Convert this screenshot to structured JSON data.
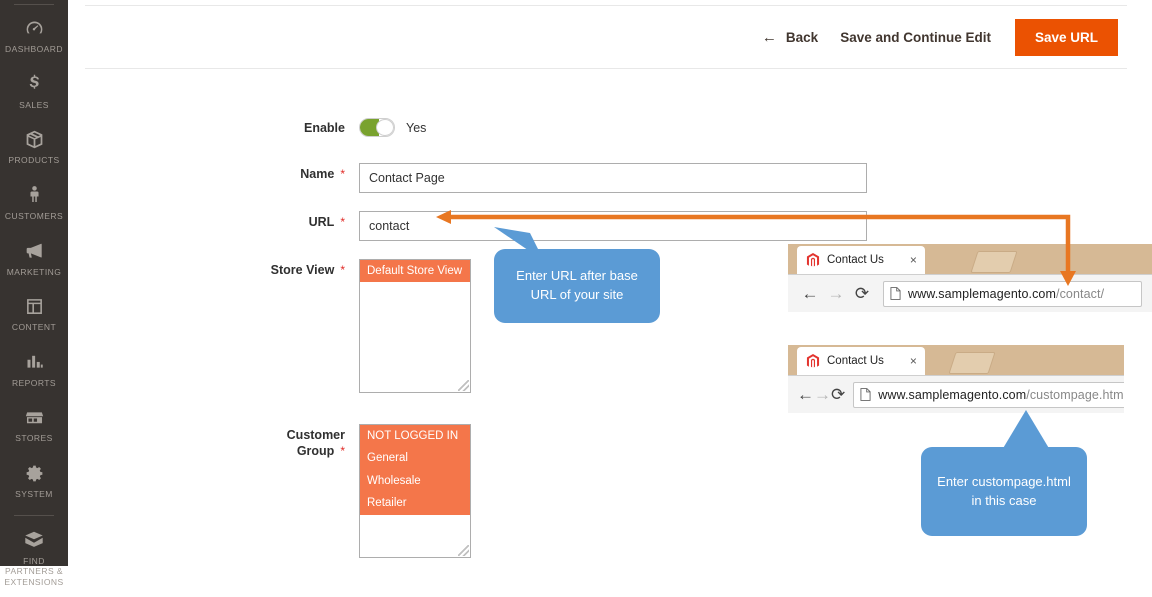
{
  "sidebar": {
    "items": [
      {
        "label": "Dashboard",
        "icon": "dashboard-gauge-icon"
      },
      {
        "label": "Sales",
        "icon": "dollar-sign-icon"
      },
      {
        "label": "Products",
        "icon": "box-icon"
      },
      {
        "label": "Customers",
        "icon": "person-icon"
      },
      {
        "label": "Marketing",
        "icon": "megaphone-icon"
      },
      {
        "label": "Content",
        "icon": "layout-page-icon"
      },
      {
        "label": "Reports",
        "icon": "bar-chart-icon"
      },
      {
        "label": "Stores",
        "icon": "storefront-icon"
      },
      {
        "label": "System",
        "icon": "gear-icon"
      },
      {
        "label": "Find Partners & Extensions",
        "icon": "open-box-icon"
      }
    ]
  },
  "header": {
    "back_label": "Back",
    "back_arrow": "←",
    "save_continue_label": "Save and Continue Edit",
    "save_label": "Save URL",
    "primary_color": "#eb5202"
  },
  "form": {
    "enable": {
      "label": "Enable",
      "toggle_state": "on",
      "toggle_text": "Yes",
      "toggle_color": "#79a22e"
    },
    "name": {
      "label": "Name",
      "required_marker": "*",
      "value": "Contact Page",
      "placeholder": ""
    },
    "url": {
      "label": "URL",
      "required_marker": "*",
      "value": "contact",
      "placeholder": ""
    },
    "store_view": {
      "label": "Store View",
      "required_marker": "*",
      "options": [
        {
          "label": "Default Store View",
          "selected": true
        }
      ],
      "selected_color": "#f4764a"
    },
    "customer_group": {
      "label": "Customer Group",
      "required_marker": "*",
      "options": [
        {
          "label": "NOT LOGGED IN",
          "selected": true
        },
        {
          "label": "General",
          "selected": true
        },
        {
          "label": "Wholesale",
          "selected": true
        },
        {
          "label": "Retailer",
          "selected": true
        }
      ],
      "selected_color": "#f4764a"
    }
  },
  "browsers": [
    {
      "tab_title": "Contact Us",
      "tab_close": "×",
      "favicon": "magento-logo-icon",
      "back_arrow": "←",
      "forward_arrow": "→",
      "reload": "⟳",
      "url_prefix": "www.samplemagento.com",
      "url_suffix": "/contact/"
    },
    {
      "tab_title": "Contact Us",
      "tab_close": "×",
      "favicon": "magento-logo-icon",
      "back_arrow": "←",
      "forward_arrow": "→",
      "reload": "⟳",
      "url_prefix": "www.samplemagento.com",
      "url_suffix": "/custompage.html"
    }
  ],
  "callouts": [
    {
      "text": "Enter URL after base URL of your site",
      "color": "#5b9bd5"
    },
    {
      "text": "Enter custompage.html in this case",
      "color": "#5b9bd5"
    }
  ],
  "annotation": {
    "connector_color": "#e87722"
  }
}
